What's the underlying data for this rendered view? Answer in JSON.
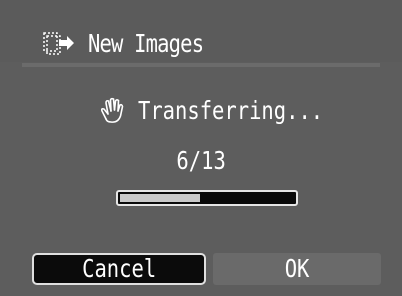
{
  "header": {
    "title": "New Images",
    "icon": "transfer-images-icon"
  },
  "status": {
    "text": "Transferring...",
    "icon": "hand-icon"
  },
  "progress": {
    "current": 6,
    "total": 13,
    "label": "6/13"
  },
  "buttons": {
    "cancel_label": "Cancel",
    "ok_label": "OK"
  },
  "colors": {
    "background": "#5d5d5d",
    "text": "#ffffff",
    "selected_button": "#0b0b0b",
    "progress_fill": "#c9c9c9"
  }
}
